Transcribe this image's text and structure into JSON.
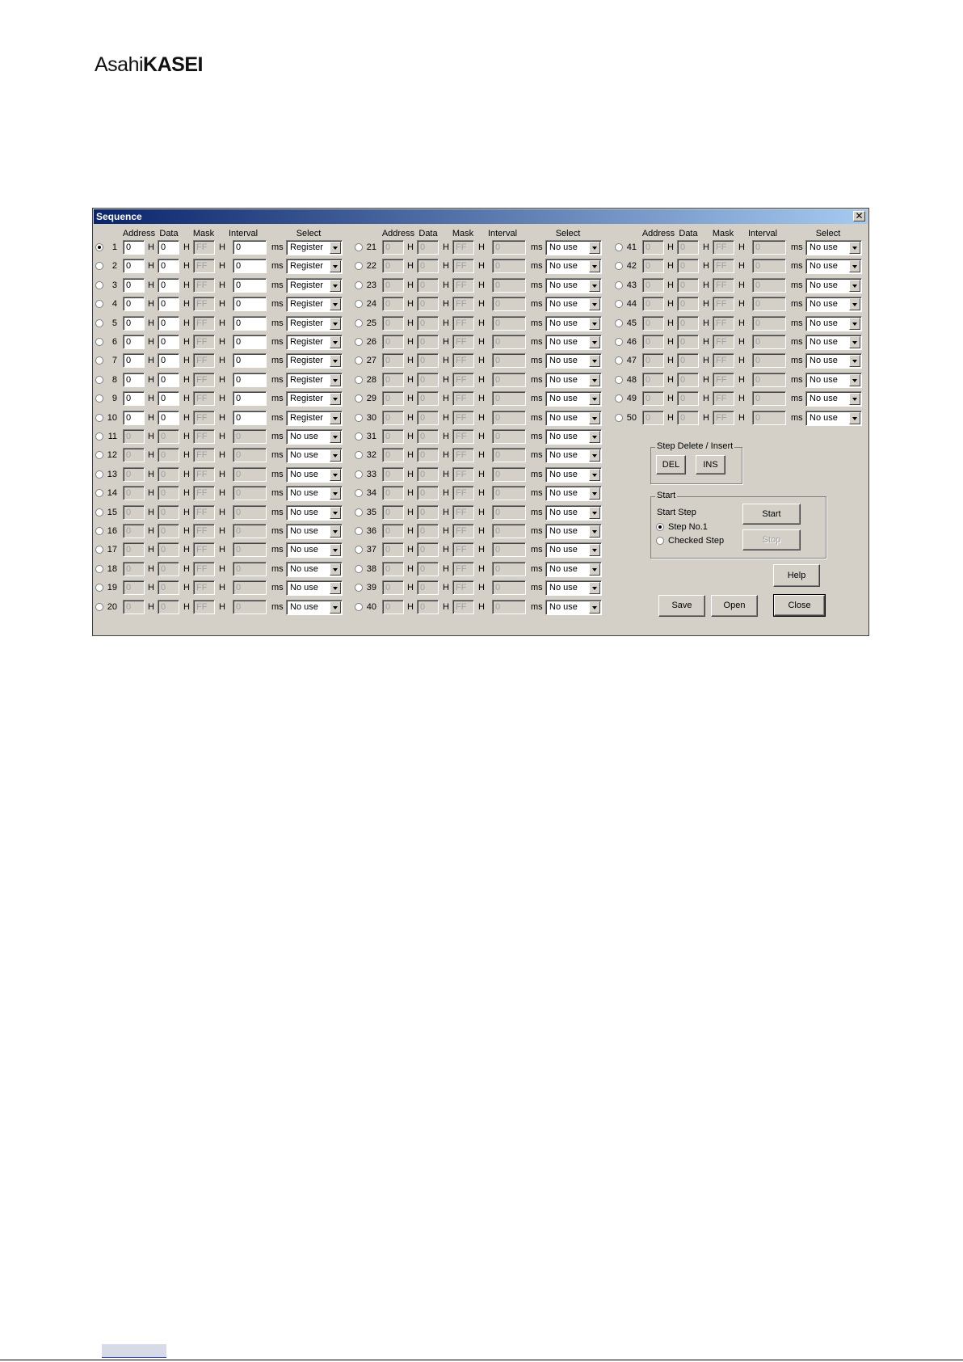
{
  "logo": {
    "part1": "Asahi",
    "part2": "KASEI"
  },
  "dialog": {
    "title": "Sequence",
    "close_glyph": "✕",
    "headers": {
      "address": "Address",
      "data": "Data",
      "mask": "Mask",
      "interval": "Interval",
      "select": "Select"
    },
    "units": {
      "hex": "H",
      "ms": "ms"
    },
    "rows": [
      {
        "num": "1",
        "address": "0",
        "data": "0",
        "mask": "FF",
        "interval": "0",
        "select": "Register",
        "enabled": true,
        "checked": true
      },
      {
        "num": "2",
        "address": "0",
        "data": "0",
        "mask": "FF",
        "interval": "0",
        "select": "Register",
        "enabled": true
      },
      {
        "num": "3",
        "address": "0",
        "data": "0",
        "mask": "FF",
        "interval": "0",
        "select": "Register",
        "enabled": true
      },
      {
        "num": "4",
        "address": "0",
        "data": "0",
        "mask": "FF",
        "interval": "0",
        "select": "Register",
        "enabled": true
      },
      {
        "num": "5",
        "address": "0",
        "data": "0",
        "mask": "FF",
        "interval": "0",
        "select": "Register",
        "enabled": true
      },
      {
        "num": "6",
        "address": "0",
        "data": "0",
        "mask": "FF",
        "interval": "0",
        "select": "Register",
        "enabled": true
      },
      {
        "num": "7",
        "address": "0",
        "data": "0",
        "mask": "FF",
        "interval": "0",
        "select": "Register",
        "enabled": true
      },
      {
        "num": "8",
        "address": "0",
        "data": "0",
        "mask": "FF",
        "interval": "0",
        "select": "Register",
        "enabled": true
      },
      {
        "num": "9",
        "address": "0",
        "data": "0",
        "mask": "FF",
        "interval": "0",
        "select": "Register",
        "enabled": true
      },
      {
        "num": "10",
        "address": "0",
        "data": "0",
        "mask": "FF",
        "interval": "0",
        "select": "Register",
        "enabled": true
      },
      {
        "num": "11",
        "address": "0",
        "data": "0",
        "mask": "FF",
        "interval": "0",
        "select": "No use"
      },
      {
        "num": "12",
        "address": "0",
        "data": "0",
        "mask": "FF",
        "interval": "0",
        "select": "No use"
      },
      {
        "num": "13",
        "address": "0",
        "data": "0",
        "mask": "FF",
        "interval": "0",
        "select": "No use"
      },
      {
        "num": "14",
        "address": "0",
        "data": "0",
        "mask": "FF",
        "interval": "0",
        "select": "No use"
      },
      {
        "num": "15",
        "address": "0",
        "data": "0",
        "mask": "FF",
        "interval": "0",
        "select": "No use"
      },
      {
        "num": "16",
        "address": "0",
        "data": "0",
        "mask": "FF",
        "interval": "0",
        "select": "No use"
      },
      {
        "num": "17",
        "address": "0",
        "data": "0",
        "mask": "FF",
        "interval": "0",
        "select": "No use"
      },
      {
        "num": "18",
        "address": "0",
        "data": "0",
        "mask": "FF",
        "interval": "0",
        "select": "No use"
      },
      {
        "num": "19",
        "address": "0",
        "data": "0",
        "mask": "FF",
        "interval": "0",
        "select": "No use"
      },
      {
        "num": "20",
        "address": "0",
        "data": "0",
        "mask": "FF",
        "interval": "0",
        "select": "No use"
      },
      {
        "num": "21",
        "address": "0",
        "data": "0",
        "mask": "FF",
        "interval": "0",
        "select": "No use"
      },
      {
        "num": "22",
        "address": "0",
        "data": "0",
        "mask": "FF",
        "interval": "0",
        "select": "No use"
      },
      {
        "num": "23",
        "address": "0",
        "data": "0",
        "mask": "FF",
        "interval": "0",
        "select": "No use"
      },
      {
        "num": "24",
        "address": "0",
        "data": "0",
        "mask": "FF",
        "interval": "0",
        "select": "No use"
      },
      {
        "num": "25",
        "address": "0",
        "data": "0",
        "mask": "FF",
        "interval": "0",
        "select": "No use"
      },
      {
        "num": "26",
        "address": "0",
        "data": "0",
        "mask": "FF",
        "interval": "0",
        "select": "No use"
      },
      {
        "num": "27",
        "address": "0",
        "data": "0",
        "mask": "FF",
        "interval": "0",
        "select": "No use"
      },
      {
        "num": "28",
        "address": "0",
        "data": "0",
        "mask": "FF",
        "interval": "0",
        "select": "No use"
      },
      {
        "num": "29",
        "address": "0",
        "data": "0",
        "mask": "FF",
        "interval": "0",
        "select": "No use"
      },
      {
        "num": "30",
        "address": "0",
        "data": "0",
        "mask": "FF",
        "interval": "0",
        "select": "No use"
      },
      {
        "num": "31",
        "address": "0",
        "data": "0",
        "mask": "FF",
        "interval": "0",
        "select": "No use"
      },
      {
        "num": "32",
        "address": "0",
        "data": "0",
        "mask": "FF",
        "interval": "0",
        "select": "No use"
      },
      {
        "num": "33",
        "address": "0",
        "data": "0",
        "mask": "FF",
        "interval": "0",
        "select": "No use"
      },
      {
        "num": "34",
        "address": "0",
        "data": "0",
        "mask": "FF",
        "interval": "0",
        "select": "No use"
      },
      {
        "num": "35",
        "address": "0",
        "data": "0",
        "mask": "FF",
        "interval": "0",
        "select": "No use"
      },
      {
        "num": "36",
        "address": "0",
        "data": "0",
        "mask": "FF",
        "interval": "0",
        "select": "No use"
      },
      {
        "num": "37",
        "address": "0",
        "data": "0",
        "mask": "FF",
        "interval": "0",
        "select": "No use"
      },
      {
        "num": "38",
        "address": "0",
        "data": "0",
        "mask": "FF",
        "interval": "0",
        "select": "No use"
      },
      {
        "num": "39",
        "address": "0",
        "data": "0",
        "mask": "FF",
        "interval": "0",
        "select": "No use"
      },
      {
        "num": "40",
        "address": "0",
        "data": "0",
        "mask": "FF",
        "interval": "0",
        "select": "No use"
      },
      {
        "num": "41",
        "address": "0",
        "data": "0",
        "mask": "FF",
        "interval": "0",
        "select": "No use"
      },
      {
        "num": "42",
        "address": "0",
        "data": "0",
        "mask": "FF",
        "interval": "0",
        "select": "No use"
      },
      {
        "num": "43",
        "address": "0",
        "data": "0",
        "mask": "FF",
        "interval": "0",
        "select": "No use"
      },
      {
        "num": "44",
        "address": "0",
        "data": "0",
        "mask": "FF",
        "interval": "0",
        "select": "No use"
      },
      {
        "num": "45",
        "address": "0",
        "data": "0",
        "mask": "FF",
        "interval": "0",
        "select": "No use"
      },
      {
        "num": "46",
        "address": "0",
        "data": "0",
        "mask": "FF",
        "interval": "0",
        "select": "No use"
      },
      {
        "num": "47",
        "address": "0",
        "data": "0",
        "mask": "FF",
        "interval": "0",
        "select": "No use"
      },
      {
        "num": "48",
        "address": "0",
        "data": "0",
        "mask": "FF",
        "interval": "0",
        "select": "No use"
      },
      {
        "num": "49",
        "address": "0",
        "data": "0",
        "mask": "FF",
        "interval": "0",
        "select": "No use"
      },
      {
        "num": "50",
        "address": "0",
        "data": "0",
        "mask": "FF",
        "interval": "0",
        "select": "No use"
      }
    ],
    "step_delete_insert": {
      "title": "Step Delete / Insert",
      "del": "DEL",
      "ins": "INS"
    },
    "start_group": {
      "title": "Start",
      "start_step_label": "Start Step",
      "option1": "Step No.1",
      "option2": "Checked Step",
      "start_btn": "Start",
      "stop_btn": "Stop"
    },
    "help_btn": "Help",
    "save_btn": "Save",
    "open_btn": "Open",
    "close_btn": "Close"
  },
  "colors": {
    "titlebar_start": "#0a246a",
    "titlebar_end": "#a6caf0",
    "dialog_bg": "#d4d0c8"
  }
}
